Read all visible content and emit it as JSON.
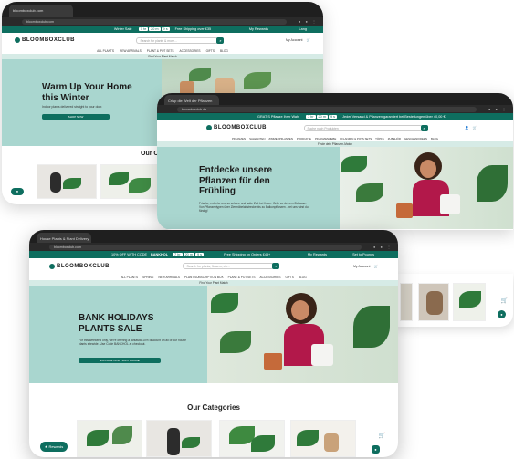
{
  "win1": {
    "tab": "bloomboxclub.com",
    "url": "bloomboxclub.com",
    "promo_left": "Winter Sale",
    "countdown": [
      "7 hr",
      "20 m",
      "9 s"
    ],
    "promo_right": "Free Shipping over £35",
    "rewards": "My Rewards",
    "lang": "Lang",
    "logo": "BLOOMBOXCLUB",
    "search_placeholder": "Search for plants & more...",
    "account": "My Account",
    "nav": [
      "ALL PLANTS",
      "NEW ARRIVALS",
      "PLANT & POT SETS",
      "ACCESSORIES",
      "GIFTS",
      "BLOG"
    ],
    "sub": "Find Your Plant Match",
    "title": "Warm Up Your Home this Winter",
    "body": "Indoor plants delivered straight to your door.",
    "cta": "SHOP NOW",
    "section": "Our C"
  },
  "win2": {
    "tab": "Crisp die Welt der Pflanzen",
    "url": "bloomboxclub.de",
    "promo": "GRATIS Pflanze Ihrer Wahl",
    "countdown": [
      "7 hr",
      "20 m",
      "9 s"
    ],
    "promo_right": "Jeder Versand & Pflanzen garantiert bei Bestellungen über 40,00 €",
    "logo": "BLOOMBOXCLUB",
    "search_placeholder": "Suche nach Produkten",
    "nav": [
      "PFLANZEN",
      "SALEBOTEN",
      "ZIMMERPFLANZEN",
      "PRODUKTE",
      "PFLANZENLIEBE",
      "PFLANZEN & POTS SETS",
      "TÖPFE",
      "ZUBEHÖR",
      "GESCHENKIDEEN",
      "BLOG"
    ],
    "sub": "Finde dein Pflanzen-Match",
    "title": "Entdecke unsere Pflanzen für den Frühling",
    "body": "Frische, erdliche und so schöne und satte Zeit bei Ihnen. Grün zu deinem Zuhause. Von Pflanzentypen über Ziermöbelabstrecke bis zu Balkonpflanzen - bei uns wirst du fündig!"
  },
  "win3": {
    "tab": "House Plants & Plant Delivery",
    "url": "bloomboxclub.com",
    "promo_left": "10% OFF WITH CODE",
    "code": "BANKHOL",
    "countdown": [
      "7 hr",
      "20 m",
      "9 s"
    ],
    "promo_mid": "Free Shipping on Orders £45+",
    "rewards": "My Rewards",
    "currency": "Set to Pounds",
    "logo": "BLOOMBOXCLUB",
    "search_placeholder": "Search for plants, flowers, etc...",
    "account": "My Account",
    "nav": [
      "ALL PLANTS",
      "SPRING",
      "NEW ARRIVALS",
      "PLANT SUBSCRIPTION BOX",
      "PLANT & POT SETS",
      "ACCESSORIES",
      "GIFTS",
      "BLOG"
    ],
    "sub": "Find Your Plant Match",
    "title": "BANK HOLIDAYS PLANTS SALE",
    "body": "For this weekend only, we're offering a fantastic 10% discount on all of our house plants sitewide. Use Code BANKHOL at checkout.",
    "cta": "EXPLORE OUR PLANT RANGE",
    "section": "Our Categories",
    "rewards_btn": "Rewards"
  }
}
